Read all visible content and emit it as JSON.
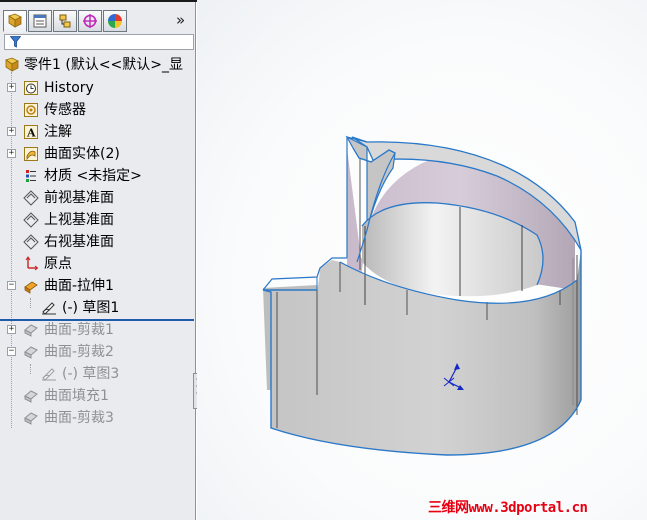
{
  "toolbar": {
    "tabs": [
      {
        "icon": "feature-manager-icon"
      },
      {
        "icon": "property-manager-icon"
      },
      {
        "icon": "configuration-manager-icon"
      },
      {
        "icon": "dimxpert-icon"
      },
      {
        "icon": "display-manager-icon"
      }
    ],
    "expand_label": "»"
  },
  "filter": {
    "icon": "filter-icon",
    "value": ""
  },
  "tree": {
    "items": [
      {
        "label": "零件1 (默认<<默认>_显",
        "icon": "part-icon"
      },
      {
        "label": "History",
        "icon": "history-icon"
      },
      {
        "label": "传感器",
        "icon": "sensor-icon"
      },
      {
        "label": "注解",
        "icon": "annotation-icon"
      },
      {
        "label": "曲面实体(2)",
        "icon": "surface-bodies-icon"
      },
      {
        "label": "材质 <未指定>",
        "icon": "material-icon"
      },
      {
        "label": "前视基准面",
        "icon": "plane-icon"
      },
      {
        "label": "上视基准面",
        "icon": "plane-icon"
      },
      {
        "label": "右视基准面",
        "icon": "plane-icon"
      },
      {
        "label": "原点",
        "icon": "origin-icon"
      },
      {
        "label": "曲面-拉伸1",
        "icon": "surface-extrude-icon"
      },
      {
        "label": "(-) 草图1",
        "icon": "sketch-icon"
      },
      {
        "label": "曲面-剪裁1",
        "icon": "surface-trim-icon"
      },
      {
        "label": "曲面-剪裁2",
        "icon": "surface-trim-icon"
      },
      {
        "label": "(-) 草图3",
        "icon": "sketch-icon"
      },
      {
        "label": "曲面填充1",
        "icon": "surface-fill-icon"
      },
      {
        "label": "曲面-剪裁3",
        "icon": "surface-trim-icon"
      }
    ]
  },
  "viewport": {
    "watermark": "三维网www.3dportal.cn",
    "colors": {
      "surface": "#c9c9c9",
      "inner": "#c6b8c8",
      "edge": "#2a78c8",
      "triad": "#1428c8"
    }
  }
}
